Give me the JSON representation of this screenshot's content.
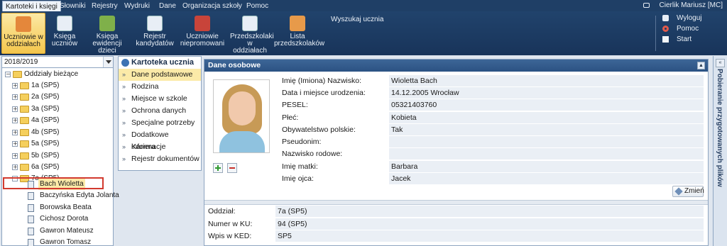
{
  "menu": {
    "items": [
      "Kartoteki i księgi",
      "Słowniki",
      "Rejestry",
      "Wydruki",
      "Dane",
      "Organizacja szkoły",
      "Pomoc"
    ],
    "user": "Cierlik Mariusz [MC]"
  },
  "toolbar": {
    "tools": [
      "Uczniowie w\noddziałach",
      "Księga\nuczniów",
      "Księga\newidencji dzieci",
      "Rejestr\nkandydatów",
      "Uczniowie\nniepromowani",
      "Przedszkolaki\nw oddziałach",
      "Lista\nprzedszkolaków"
    ],
    "search_label": "Wyszukaj ucznia",
    "actions": [
      "Wyloguj",
      "Pomoc",
      "Start"
    ]
  },
  "tree": {
    "year": "2018/2019",
    "root": "Oddziały bieżące",
    "classes": [
      "1a (SP5)",
      "2a (SP5)",
      "3a (SP5)",
      "4a (SP5)",
      "4b (SP5)",
      "5a (SP5)",
      "5b (SP5)",
      "6a (SP5)",
      "7a (SP5)"
    ],
    "students": [
      "Bach Wioletta",
      "Baczyńska Edyta Jolanta",
      "Borowska Beata",
      "Cichosz Dorota",
      "Gawron Mateusz",
      "Gawron Tomasz"
    ]
  },
  "nav": {
    "title": "Kartoteka ucznia",
    "items": [
      "Dane podstawowe",
      "Rodzina",
      "Miejsce w szkole",
      "Ochrona danych",
      "Specjalne potrzeby",
      "Dodatkowe informacje",
      "Kariera",
      "Rejestr dokumentów"
    ]
  },
  "details": {
    "title": "Dane osobowe",
    "fields": [
      {
        "label": "Imię (Imiona) Nazwisko:",
        "value": "Wioletta Bach"
      },
      {
        "label": "Data i miejsce urodzenia:",
        "value": "14.12.2005 Wrocław"
      },
      {
        "label": "PESEL:",
        "value": "05321403760"
      },
      {
        "label": "Płeć:",
        "value": "Kobieta"
      },
      {
        "label": "Obywatelstwo polskie:",
        "value": "Tak"
      },
      {
        "label": "Pseudonim:",
        "value": ""
      },
      {
        "label": "Nazwisko rodowe:",
        "value": ""
      },
      {
        "label": "Imię matki:",
        "value": "Barbara"
      },
      {
        "label": "Imię ojca:",
        "value": "Jacek"
      }
    ],
    "edit_label": "Zmień",
    "bottom_fields": [
      {
        "label": "Oddział:",
        "value": "7a (SP5)"
      },
      {
        "label": "Numer w KU:",
        "value": "94 (SP5)"
      },
      {
        "label": "Wpis w KED:",
        "value": "SP5"
      }
    ]
  },
  "side_panel": {
    "title": "Pobieranie przygotowanych plików"
  }
}
